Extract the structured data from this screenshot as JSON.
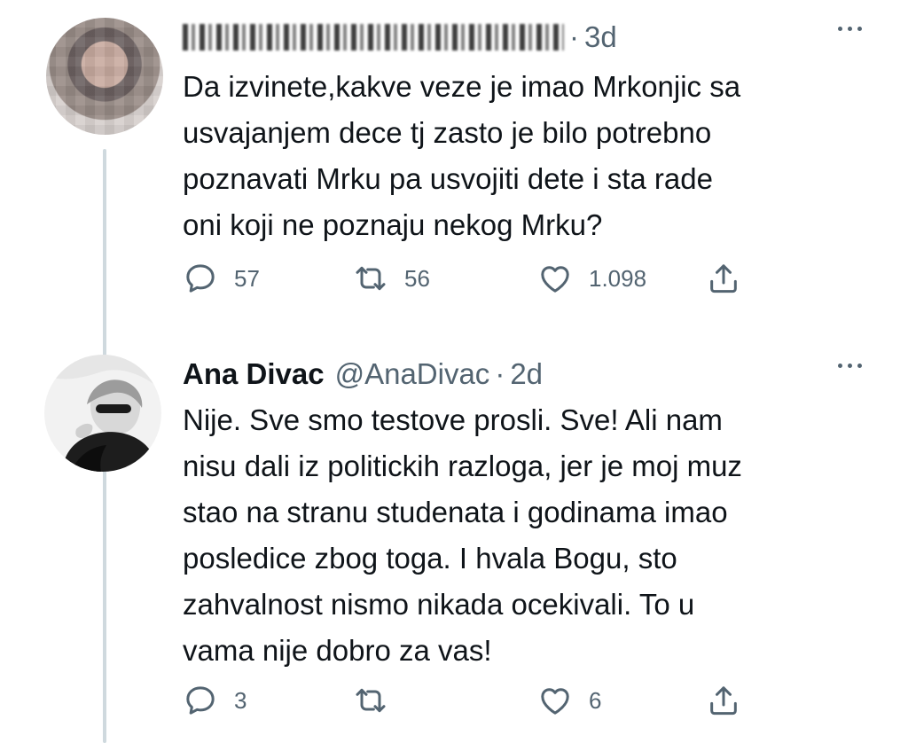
{
  "tweets": [
    {
      "name": "",
      "handle": "",
      "time": "3d",
      "text_lines": [
        "Da izvinete,kakve veze je imao Mrkonjic sa",
        "usvajanjem dece tj zasto je bilo potrebno",
        "poznavati Mrku pa usvojiti dete i sta rade",
        "oni koji ne poznaju nekog Mrku?"
      ],
      "replies": "57",
      "retweets": "56",
      "likes": "1.098"
    },
    {
      "name": "Ana Divac",
      "handle": "@AnaDivac",
      "time": "2d",
      "text_lines": [
        "Nije. Sve smo testove prosli. Sve! Ali nam",
        "nisu dali iz politickih razloga, jer je moj muz",
        "stao na stranu studenata i godinama imao",
        "posledice zbog toga. I hvala Bogu, sto",
        "zahvalnost nismo nikada ocekivali. To u",
        "vama nije dobro za vas!"
      ],
      "replies": "3",
      "retweets": "",
      "likes": "6"
    }
  ],
  "separator": "·",
  "icons": {
    "reply": "reply-icon",
    "retweet": "retweet-icon",
    "like": "heart-icon",
    "share": "share-icon",
    "more": "more-icon"
  },
  "colors": {
    "text": "#0f1419",
    "muted": "#536471",
    "thread_line": "#cfd9de"
  }
}
